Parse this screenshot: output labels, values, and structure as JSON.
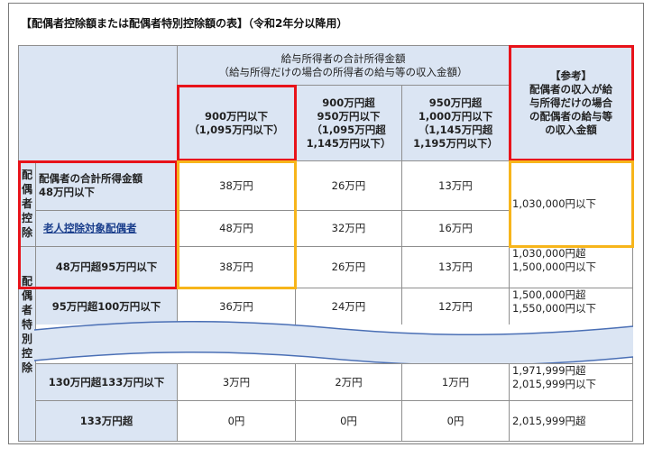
{
  "title": "【配偶者控除額または配偶者特別控除額の表】（令和2年分以降用）",
  "header": {
    "group_line1": "給与所得者の合計所得金額",
    "group_line2": "（給与所得だけの場合の所得者の給与等の収入金額）",
    "col1": [
      "900万円以下",
      "（1,095万円以下）"
    ],
    "col2": [
      "900万円超",
      "950万円以下",
      "（1,095万円超",
      "1,145万円以下）"
    ],
    "col3": [
      "950万円超",
      "1,000万円以下",
      "（1,145万円超",
      "1,195万円以下）"
    ],
    "ref": [
      "【参考】",
      "配偶者の収入が給",
      "与所得だけの場合",
      "の配偶者の給与等",
      "の収入金額"
    ]
  },
  "side": {
    "kojo_chars": [
      "配",
      "偶",
      "者",
      "控",
      "除"
    ],
    "tokubetsu_chars": [
      "配",
      "偶",
      "者",
      "特",
      "別",
      "控",
      "除"
    ]
  },
  "rows": [
    {
      "label": [
        "配偶者の合計所得金額",
        "48万円以下"
      ],
      "v1": "38万円",
      "v2": "26万円",
      "v3": "13万円"
    },
    {
      "label": [
        "老人控除対象配偶者"
      ],
      "v1": "48万円",
      "v2": "32万円",
      "v3": "16万円"
    },
    {
      "label": [
        "48万円超95万円以下"
      ],
      "v1": "38万円",
      "v2": "26万円",
      "v3": "13万円",
      "ref": [
        "1,030,000円超",
        "1,500,000円以下"
      ]
    },
    {
      "label": [
        "95万円超100万円以下"
      ],
      "v1": "36万円",
      "v2": "24万円",
      "v3": "12万円",
      "ref": [
        "1,500,000円超",
        "1,550,000円以下"
      ]
    },
    {
      "label": [
        "130万円超133万円以下"
      ],
      "v1": "3万円",
      "v2": "2万円",
      "v3": "1万円",
      "ref": [
        "1,971,999円超",
        "2,015,999円以下"
      ]
    },
    {
      "label": [
        "133万円超"
      ],
      "v1": "0円",
      "v2": "0円",
      "v3": "0円",
      "ref": [
        "2,015,999円超"
      ]
    }
  ],
  "ref_merged": "1,030,000円以下",
  "colors": {
    "header_bg": "#dbe5f3",
    "red_outline": "#e8131a",
    "orange_outline": "#f7b51b",
    "link": "#1a3e8c"
  }
}
